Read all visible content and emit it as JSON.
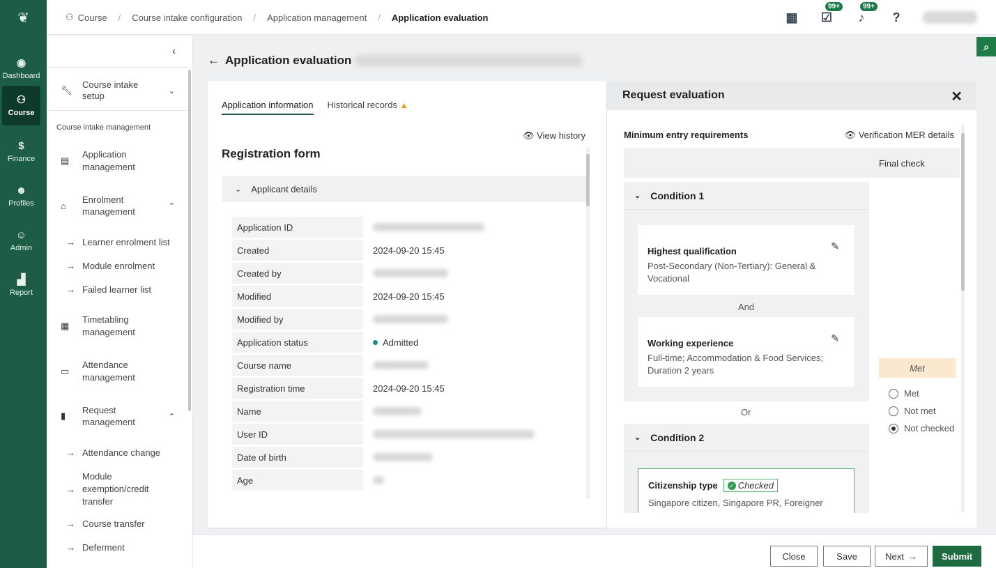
{
  "rail": {
    "items": [
      {
        "label": "Dashboard",
        "icon": "compass-icon"
      },
      {
        "label": "Course",
        "icon": "course-icon"
      },
      {
        "label": "Finance",
        "icon": "dollar-icon"
      },
      {
        "label": "Profiles",
        "icon": "people-icon"
      },
      {
        "label": "Admin",
        "icon": "admin-icon"
      },
      {
        "label": "Report",
        "icon": "chart-icon"
      }
    ]
  },
  "breadcrumb": [
    "Course",
    "Course intake configuration",
    "Application management",
    "Application evaluation"
  ],
  "topbar": {
    "tasks_badge": "99+",
    "notif_badge": "99+"
  },
  "sidenav": {
    "section_title": "Course intake management",
    "items": {
      "setup": "Course intake setup",
      "app_mgmt": "Application management",
      "enrol_mgmt": "Enrolment management",
      "timetabling": "Timetabling management",
      "attendance": "Attendance management",
      "request": "Request management"
    },
    "enrol_subs": [
      "Learner enrolment list",
      "Module enrolment",
      "Failed learner list"
    ],
    "request_subs": [
      "Attendance change",
      "Module exemption/credit transfer",
      "Course transfer",
      "Deferment"
    ]
  },
  "page": {
    "title": "Application evaluation"
  },
  "tabs": [
    "Application information",
    "Historical records"
  ],
  "view_history": "View history",
  "form": {
    "title": "Registration form",
    "section": "Applicant details",
    "rows": [
      {
        "label": "Application ID",
        "value": ""
      },
      {
        "label": "Created",
        "value": "2024-09-20 15:45"
      },
      {
        "label": "Created by",
        "value": ""
      },
      {
        "label": "Modified",
        "value": "2024-09-20 15:45"
      },
      {
        "label": "Modified by",
        "value": ""
      },
      {
        "label": "Application status",
        "value": "Admitted"
      },
      {
        "label": "Course name",
        "value": ""
      },
      {
        "label": "Registration time",
        "value": "2024-09-20 15:45"
      },
      {
        "label": "Name",
        "value": ""
      },
      {
        "label": "User ID",
        "value": ""
      },
      {
        "label": "Date of birth",
        "value": ""
      },
      {
        "label": "Age",
        "value": ""
      }
    ]
  },
  "panel": {
    "title": "Request evaluation",
    "mer_title": "Minimum entry requirements",
    "mer_link": "Verification MER details",
    "final_check": "Final check",
    "cond1": {
      "title": "Condition 1",
      "q1_title": "Highest qualification",
      "q1_desc": "Post-Secondary (Non-Tertiary): General & Vocational",
      "and": "And",
      "q2_title": "Working experience",
      "q2_desc": "Full-time; Accommodation & Food Services; Duration 2 years"
    },
    "or": "Or",
    "cond2": {
      "title": "Condition 2",
      "c_title": "Citizenship type",
      "checked": "Checked",
      "c_desc": "Singapore citizen, Singapore PR, Foreigner"
    },
    "status": "Met",
    "radios": [
      "Met",
      "Not met",
      "Not checked"
    ],
    "selected": "Not checked"
  },
  "footer": {
    "close": "Close",
    "save": "Save",
    "next": "Next",
    "submit": "Submit"
  }
}
